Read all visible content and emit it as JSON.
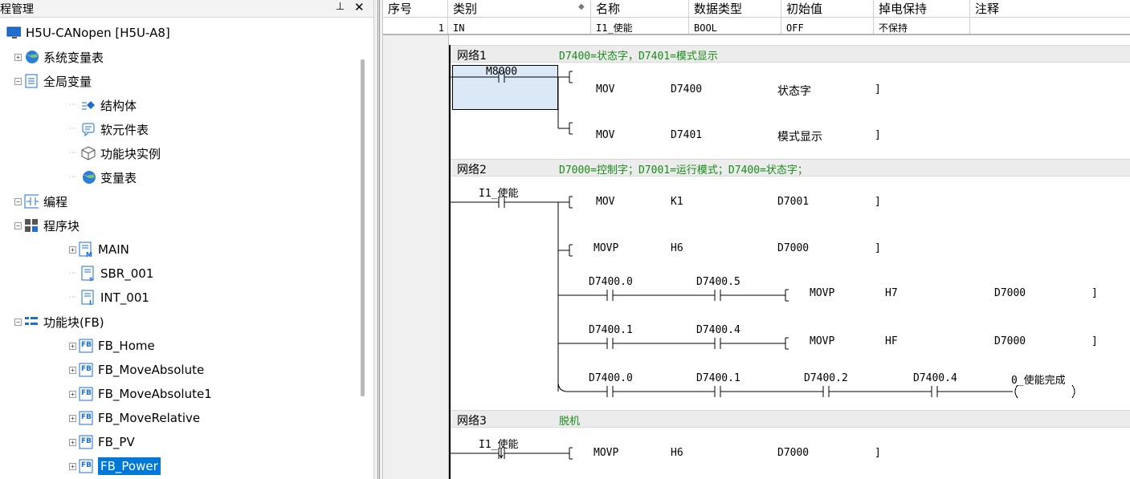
{
  "left_panel": {
    "title": "程管理",
    "pin_glyph": "⊥",
    "close_glyph": "✕",
    "tree": [
      {
        "label": "H5U-CANopen [H5U-A8]",
        "icon": "monitor-icon",
        "toggle": "",
        "level": 0
      },
      {
        "label": "系统变量表",
        "icon": "globe-icon",
        "toggle": "+",
        "level": 1
      },
      {
        "label": "全局变量",
        "icon": "document-list-icon",
        "toggle": "−",
        "level": 1
      },
      {
        "label": "结构体",
        "icon": "struct-icon",
        "toggle": "",
        "level": 2
      },
      {
        "label": "软元件表",
        "icon": "chat-table-icon",
        "toggle": "",
        "level": 2
      },
      {
        "label": "功能块实例",
        "icon": "cube-icon",
        "toggle": "",
        "level": 2
      },
      {
        "label": "变量表",
        "icon": "globe-icon",
        "toggle": "",
        "level": 2
      },
      {
        "label": "编程",
        "icon": "ladder-contact-icon",
        "toggle": "−",
        "level": 0
      },
      {
        "label": "程序块",
        "icon": "grid-blocks-icon",
        "toggle": "−",
        "level": 1
      },
      {
        "label": "MAIN",
        "icon": "program-m-icon",
        "toggle": "+",
        "level": 2
      },
      {
        "label": "SBR_001",
        "icon": "program-s-icon",
        "toggle": "",
        "level": 2
      },
      {
        "label": "INT_001",
        "icon": "program-i-icon",
        "toggle": "",
        "level": 2
      },
      {
        "label": "功能块(FB)",
        "icon": "fb-list-icon",
        "toggle": "−",
        "level": 1
      },
      {
        "label": "FB_Home",
        "icon": "fb-icon",
        "toggle": "+",
        "level": 2
      },
      {
        "label": "FB_MoveAbsolute",
        "icon": "fb-icon",
        "toggle": "+",
        "level": 2
      },
      {
        "label": "FB_MoveAbsolute1",
        "icon": "fb-icon",
        "toggle": "+",
        "level": 2
      },
      {
        "label": "FB_MoveRelative",
        "icon": "fb-icon",
        "toggle": "+",
        "level": 2
      },
      {
        "label": "FB_PV",
        "icon": "fb-icon",
        "toggle": "+",
        "level": 2
      },
      {
        "label": "FB_Power",
        "icon": "fb-icon",
        "toggle": "+",
        "level": 2,
        "selected": true
      }
    ],
    "fb_icon_text": "FB",
    "selection_color": "#0078d7"
  },
  "var_table": {
    "headers": [
      "序号",
      "类别",
      "名称",
      "数据类型",
      "初始值",
      "掉电保持",
      "注释"
    ],
    "rows": [
      [
        "1",
        "IN",
        "I1_使能",
        "BOOL",
        "OFF",
        "不保持",
        ""
      ]
    ]
  },
  "ladder": {
    "comment_color": "#1a8a1a",
    "networks": [
      {
        "label": "网络1",
        "comment": "D7400=状态字，D7401=模式显示",
        "contact": "M8000",
        "instructions": [
          {
            "op": "MOV",
            "a": "D7400",
            "b": "状态字"
          },
          {
            "op": "MOV",
            "a": "D7401",
            "b": "模式显示"
          }
        ]
      },
      {
        "label": "网络2",
        "comment": "D7000=控制字；D7001=运行模式；D7400=状态字；",
        "contact": "I1_使能",
        "instructions": [
          {
            "op": "MOV",
            "a": "K1",
            "b": "D7001"
          },
          {
            "op": "MOVP",
            "a": "H6",
            "b": "D7000"
          }
        ],
        "branches": [
          {
            "contacts": [
              "D7400.0",
              "D7400.5"
            ],
            "op": "MOVP",
            "a": "H7",
            "b": "D7000"
          },
          {
            "contacts": [
              "D7400.1",
              "D7400.4"
            ],
            "op": "MOVP",
            "a": "HF",
            "b": "D7000"
          },
          {
            "contacts": [
              "D7400.0",
              "D7400.1",
              "D7400.2",
              "D7400.4"
            ],
            "coil": "0_使能完成"
          }
        ]
      },
      {
        "label": "网络3",
        "comment": "脱机",
        "contact": "I1_使能",
        "instructions": [
          {
            "op": "MOVP",
            "a": "H6",
            "b": "D7000"
          }
        ]
      }
    ]
  }
}
